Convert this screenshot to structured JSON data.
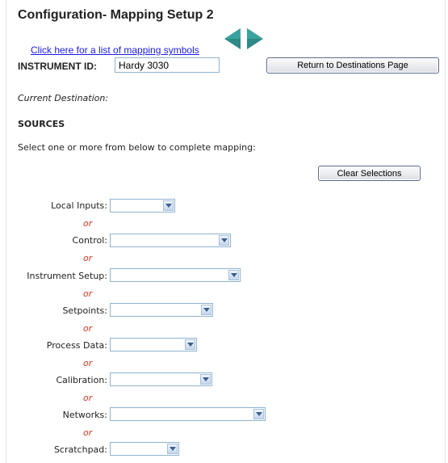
{
  "page": {
    "title": "Configuration- Mapping Setup 2"
  },
  "symbols_link": "Click here for a list of mapping symbols",
  "nav": {
    "prev_icon": "triangle-left-icon",
    "next_icon": "triangle-right-icon",
    "color": "#2e8a86"
  },
  "instrument": {
    "label": "INSTRUMENT ID:",
    "value": "Hardy 3030"
  },
  "return_button": "Return to Destinations Page",
  "current_destination_label": "Current Destination:",
  "sources_heading": "SOURCES",
  "instruction": "Select one or more from below to complete mapping:",
  "clear_button": "Clear Selections",
  "or_text": "or",
  "or_color": "#e0331e",
  "sources": [
    {
      "label": "Local Inputs:",
      "value": ""
    },
    {
      "label": "Control:",
      "value": ""
    },
    {
      "label": "Instrument Setup:",
      "value": ""
    },
    {
      "label": "Setpoints:",
      "value": ""
    },
    {
      "label": "Process Data:",
      "value": ""
    },
    {
      "label": "Calibration:",
      "value": ""
    },
    {
      "label": "Networks:",
      "value": ""
    },
    {
      "label": "Scratchpad:",
      "value": ""
    }
  ]
}
